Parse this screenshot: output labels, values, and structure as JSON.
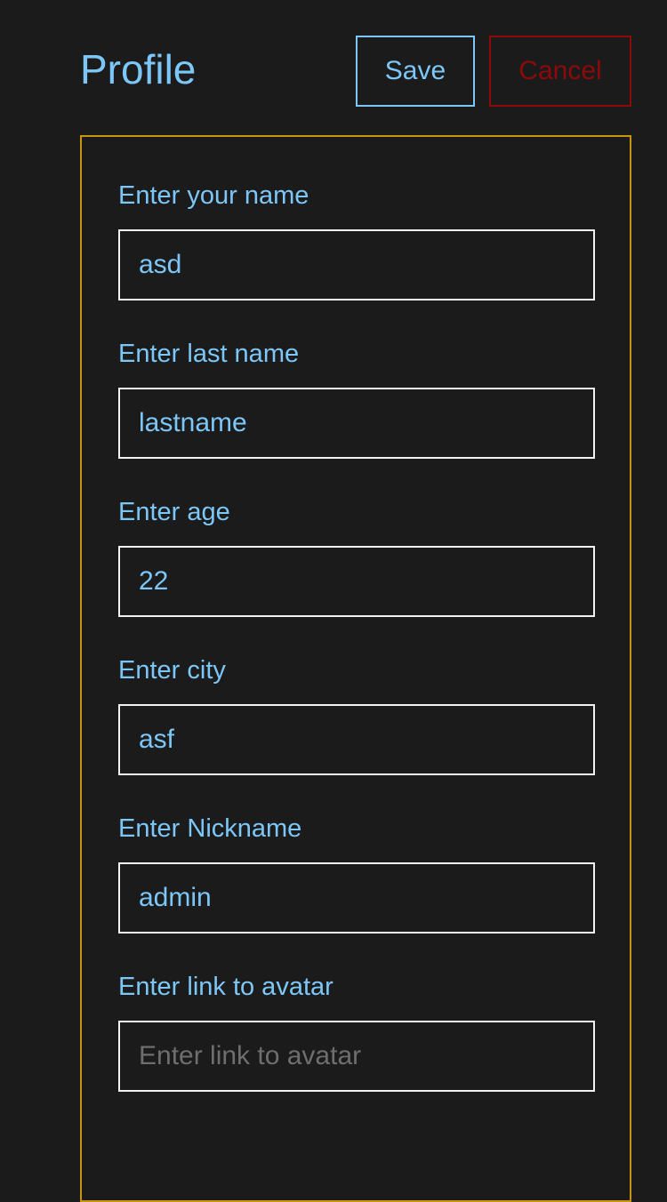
{
  "header": {
    "title": "Profile",
    "save_label": "Save",
    "cancel_label": "Cancel"
  },
  "colors": {
    "accent": "#7cc7f7",
    "cancel": "#8d0a0a",
    "form_border": "#c8960c",
    "background": "#1b1b1b"
  },
  "fields": [
    {
      "label": "Enter your name",
      "value": "asd",
      "placeholder": ""
    },
    {
      "label": "Enter last name",
      "value": "lastname",
      "placeholder": ""
    },
    {
      "label": "Enter age",
      "value": "22",
      "placeholder": ""
    },
    {
      "label": "Enter city",
      "value": "asf",
      "placeholder": ""
    },
    {
      "label": "Enter Nickname",
      "value": "admin",
      "placeholder": ""
    },
    {
      "label": "Enter link to avatar",
      "value": "",
      "placeholder": "Enter link to avatar"
    }
  ]
}
